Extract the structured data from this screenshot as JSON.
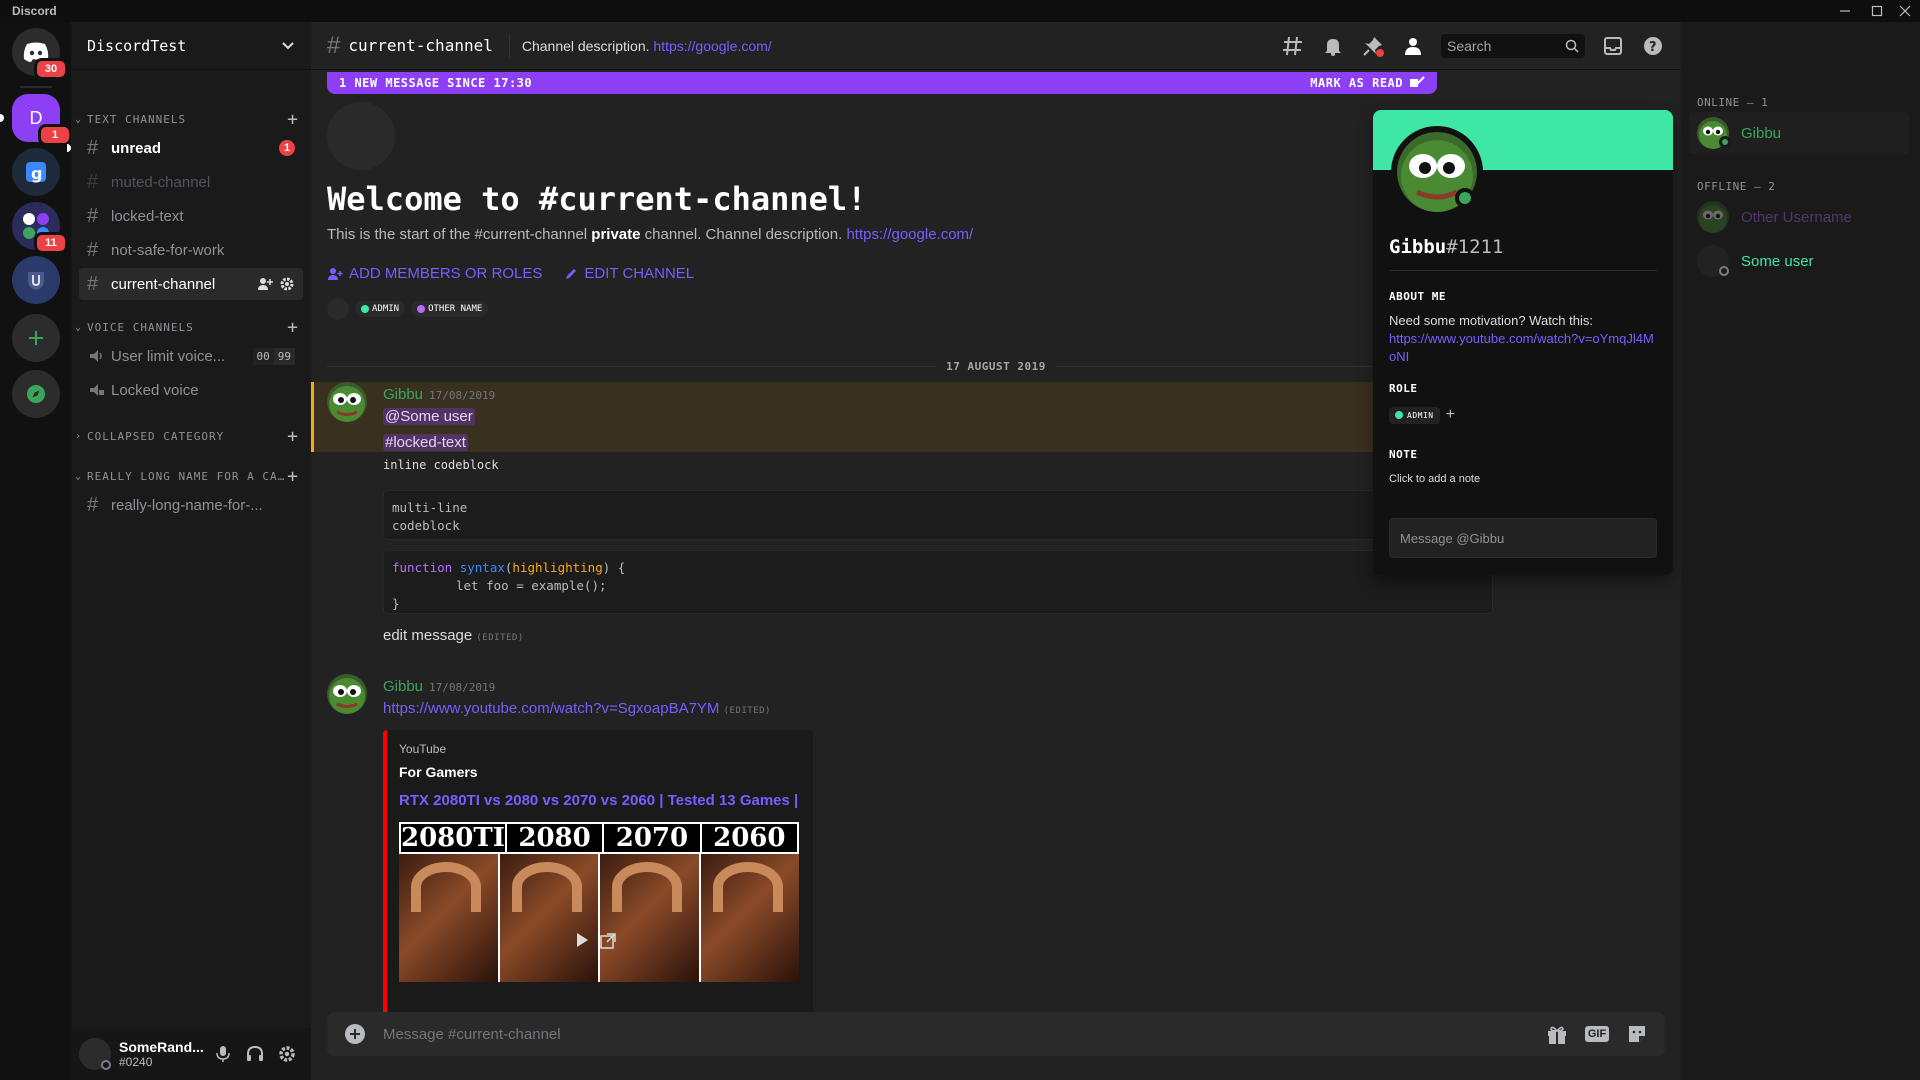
{
  "titlebar": {
    "app": "Discord"
  },
  "guilds": {
    "home_badge": "30",
    "server_letter": "D",
    "server_badge": "1",
    "folder_badge": "11"
  },
  "server": {
    "name": "DiscordTest"
  },
  "categories": {
    "text": "TEXT CHANNELS",
    "voice": "VOICE CHANNELS",
    "collapsed": "COLLAPSED CATEGORY",
    "long": "REALLY LONG NAME FOR A CAT..."
  },
  "channels": {
    "unread": {
      "name": "unread",
      "badge": "1"
    },
    "muted": {
      "name": "muted-channel"
    },
    "locked": {
      "name": "locked-text"
    },
    "nsfw": {
      "name": "not-safe-for-work"
    },
    "current": {
      "name": "current-channel"
    },
    "voice_limit": {
      "name": "User limit voice...",
      "count": "00",
      "limit": "99"
    },
    "voice_locked": {
      "name": "Locked voice"
    },
    "long": {
      "name": "really-long-name-for-..."
    }
  },
  "user_panel": {
    "username": "SomeRand...",
    "tag": "#0240"
  },
  "topbar": {
    "channel": "current-channel",
    "description": "Channel description. ",
    "link": "https://google.com/",
    "search_placeholder": "Search"
  },
  "newbar": {
    "text": "1 NEW MESSAGE SINCE 17:30",
    "action": "MARK AS READ"
  },
  "welcome": {
    "title": "Welcome to #current-channel!",
    "sub_a": "This is the start of the #current-channel ",
    "sub_b": "private",
    "sub_c": " channel. Channel description. ",
    "sub_link": "https://google.com/",
    "add_members": "ADD MEMBERS OR ROLES",
    "edit_channel": "EDIT CHANNEL",
    "role1": "ADMIN",
    "role2": "OTHER NAME"
  },
  "date_divider": "17 AUGUST 2019",
  "msg1": {
    "author": "Gibbu",
    "time": "17/08/2019",
    "mention_user": "@Some user",
    "mention_channel": "#locked-text",
    "inline_code": "inline codeblock",
    "code1_l1": "multi-line",
    "code1_l2": "codeblock",
    "code2_l1a": "function ",
    "code2_l1b": "syntax",
    "code2_l1c": "(",
    "code2_l1d": "highlighting",
    "code2_l1e": ") {",
    "code2_l2": "let foo = example();",
    "code2_l3": "}",
    "edit_text": "edit message ",
    "edited": "(EDITED)"
  },
  "msg2": {
    "author": "Gibbu",
    "time": "17/08/2019",
    "link": "https://www.youtube.com/watch?v=SgxoapBA7YM",
    "edited": "(EDITED)",
    "embed": {
      "provider": "YouTube",
      "author": "For Gamers",
      "title": "RTX 2080TI vs 2080 vs 2070 vs 2060 | Tested 13 Games |",
      "thumb_labels": [
        "2080TI",
        "2080",
        "2070",
        "2060"
      ]
    }
  },
  "composer": {
    "placeholder": "Message #current-channel",
    "gif": "GIF"
  },
  "popout": {
    "name": "Gibbu",
    "tag": "#1211",
    "about_header": "ABOUT ME",
    "about_text": "Need some motivation? Watch this:",
    "about_link": "https://www.youtube.com/watch?v=oYmqJl4MoNI",
    "role_header": "ROLE",
    "role_name": "ADMIN",
    "note_header": "NOTE",
    "note_placeholder": "Click to add a note",
    "dm_placeholder": "Message @Gibbu"
  },
  "members": {
    "online_header": "ONLINE — 1",
    "offline_header": "OFFLINE — 2",
    "online": [
      {
        "name": "Gibbu"
      }
    ],
    "offline": [
      {
        "name": "Other Username"
      },
      {
        "name": "Some user"
      }
    ]
  },
  "colors": {
    "accent": "#8c3ff5",
    "online": "#3ba55c",
    "banner": "#3ee8a4",
    "mention": "#ed4245"
  }
}
